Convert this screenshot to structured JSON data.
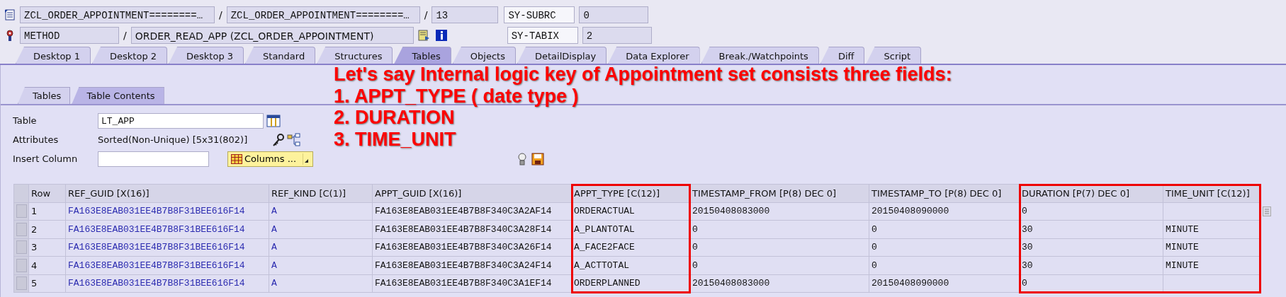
{
  "header": {
    "separator": "/",
    "row1": {
      "fields": [
        "ZCL_ORDER_APPOINTMENT========…",
        "ZCL_ORDER_APPOINTMENT========…",
        "13"
      ],
      "sysfield": "SY-SUBRC",
      "value": "0"
    },
    "row2": {
      "fields": [
        "METHOD",
        "ORDER_READ_APP (ZCL_ORDER_APPOINTMENT)"
      ],
      "sysfield": "SY-TABIX",
      "value": "2"
    }
  },
  "tabs": [
    {
      "label": "Desktop 1",
      "selected": false
    },
    {
      "label": "Desktop 2",
      "selected": false
    },
    {
      "label": "Desktop 3",
      "selected": false
    },
    {
      "label": "Standard",
      "selected": false
    },
    {
      "label": "Structures",
      "selected": false
    },
    {
      "label": "Tables",
      "selected": true
    },
    {
      "label": "Objects",
      "selected": false
    },
    {
      "label": "DetailDisplay",
      "selected": false
    },
    {
      "label": "Data Explorer",
      "selected": false
    },
    {
      "label": "Break./Watchpoints",
      "selected": false
    },
    {
      "label": "Diff",
      "selected": false
    },
    {
      "label": "Script",
      "selected": false
    }
  ],
  "subtabs": [
    {
      "label": "Tables",
      "selected": false
    },
    {
      "label": "Table Contents",
      "selected": true
    }
  ],
  "form": {
    "table_label": "Table",
    "table_value": "LT_APP",
    "attributes_label": "Attributes",
    "attributes_value": "Sorted(Non-Unique) [5x31(802)]",
    "insert_column_label": "Insert Column",
    "columns_button": "Columns ..."
  },
  "annotation": {
    "lines": [
      "Let's say Internal logic key of Appointment set consists three fields:",
      "1. APPT_TYPE ( date type )",
      "2. DURATION",
      "3. TIME_UNIT"
    ]
  },
  "grid": {
    "columns": [
      {
        "label": "Row",
        "kind": "plain",
        "highlighted": false
      },
      {
        "label": "REF_GUID [X(16)]",
        "kind": "key",
        "highlighted": false
      },
      {
        "label": "REF_KIND [C(1)]",
        "kind": "key",
        "highlighted": false
      },
      {
        "label": "APPT_GUID [X(16)]",
        "kind": "data",
        "highlighted": false
      },
      {
        "label": "APPT_TYPE [C(12)]",
        "kind": "data",
        "highlighted": true
      },
      {
        "label": "TIMESTAMP_FROM [P(8) DEC 0]",
        "kind": "data",
        "highlighted": false
      },
      {
        "label": "TIMESTAMP_TO [P(8) DEC 0]",
        "kind": "data",
        "highlighted": false
      },
      {
        "label": "DURATION [P(7) DEC 0]",
        "kind": "data",
        "highlighted": true
      },
      {
        "label": "TIME_UNIT [C(12)]",
        "kind": "data",
        "highlighted": true
      }
    ],
    "rows": [
      {
        "cells": [
          "1",
          "FA163E8EAB031EE4B7B8F31BEE616F14",
          "A",
          "FA163E8EAB031EE4B7B8F340C3A2AF14",
          "ORDERACTUAL",
          "20150408083000",
          "20150408090000",
          "0",
          ""
        ]
      },
      {
        "cells": [
          "2",
          "FA163E8EAB031EE4B7B8F31BEE616F14",
          "A",
          "FA163E8EAB031EE4B7B8F340C3A28F14",
          "A_PLANTOTAL",
          "0",
          "0",
          "30",
          "MINUTE"
        ]
      },
      {
        "cells": [
          "3",
          "FA163E8EAB031EE4B7B8F31BEE616F14",
          "A",
          "FA163E8EAB031EE4B7B8F340C3A26F14",
          "A_FACE2FACE",
          "0",
          "0",
          "30",
          "MINUTE"
        ]
      },
      {
        "cells": [
          "4",
          "FA163E8EAB031EE4B7B8F31BEE616F14",
          "A",
          "FA163E8EAB031EE4B7B8F340C3A24F14",
          "A_ACTTOTAL",
          "0",
          "0",
          "30",
          "MINUTE"
        ]
      },
      {
        "cells": [
          "5",
          "FA163E8EAB031EE4B7B8F31BEE616F14",
          "A",
          "FA163E8EAB031EE4B7B8F340C3A1EF14",
          "ORDERPLANNED",
          "20150408083000",
          "20150408090000",
          "0",
          ""
        ]
      }
    ]
  }
}
